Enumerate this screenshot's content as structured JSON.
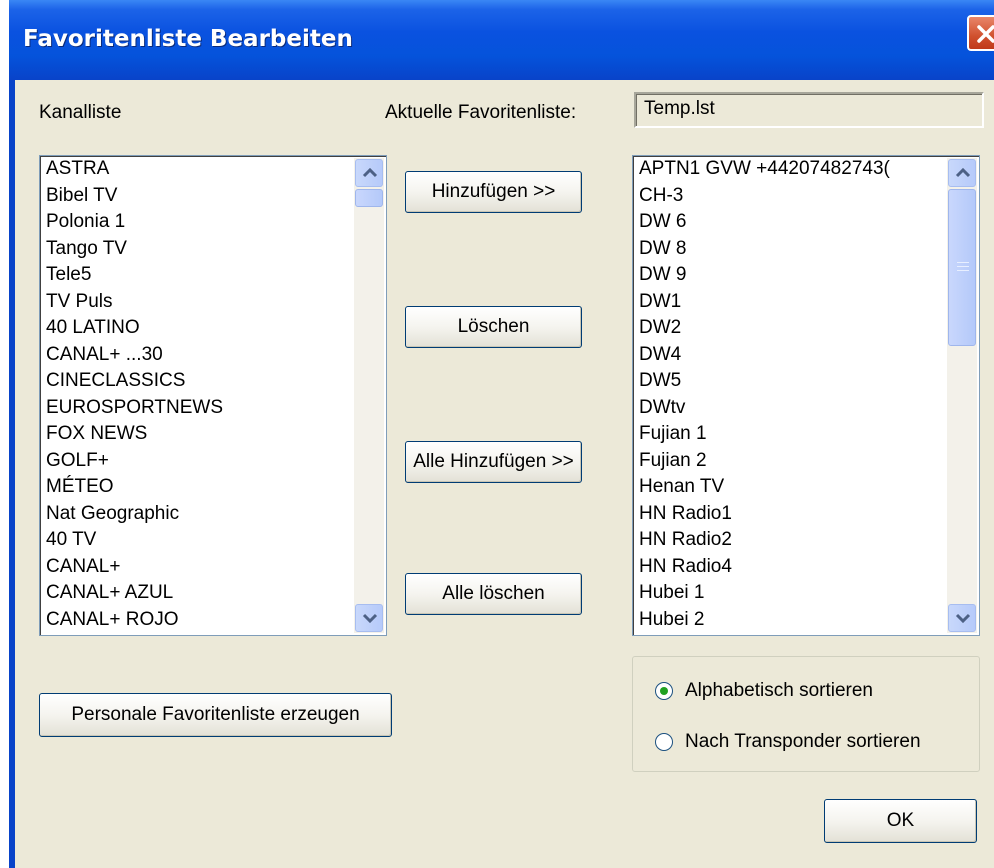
{
  "window": {
    "title": "Favoritenliste Bearbeiten"
  },
  "labels": {
    "channel_list": "Kanalliste",
    "current_favorites": "Aktuelle Favoritenliste:"
  },
  "current_favorite_file": "Temp.lst",
  "channel_list": {
    "items": [
      "ASTRA",
      "Bibel TV",
      "Polonia 1",
      "Tango TV",
      "Tele5",
      "TV Puls",
      "40 LATINO",
      "CANAL+ ...30",
      "CINECLASSICS",
      "EUROSPORTNEWS",
      "FOX NEWS",
      "GOLF+",
      "MÉTEO",
      "Nat Geographic",
      "40 TV",
      "CANAL+",
      "CANAL+ AZUL",
      "CANAL+ ROJO"
    ]
  },
  "favorite_list": {
    "items": [
      "APTN1 GVW +44207482743(",
      "CH-3",
      "DW 6",
      "DW 8",
      "DW 9",
      "DW1",
      "DW2",
      "DW4",
      "DW5",
      "DWtv",
      "Fujian 1",
      "Fujian 2",
      "Henan TV",
      "HN Radio1",
      "HN Radio2",
      "HN Radio4",
      "Hubei 1",
      "Hubei 2"
    ]
  },
  "buttons": {
    "add": "Hinzufügen >>",
    "delete": "Löschen",
    "add_all": "Alle Hinzufügen >>",
    "delete_all": "Alle löschen",
    "create_personal": "Personale Favoritenliste erzeugen",
    "ok": "OK"
  },
  "sort_options": {
    "selected": "alphabetical",
    "alphabetical": "Alphabetisch sortieren",
    "by_transponder": "Nach Transponder sortieren"
  },
  "colors": {
    "titlebar": "#0553db",
    "dialog_background": "#ece9d8",
    "close_button": "#d0502e",
    "scrollbar": "#b6cafa"
  }
}
